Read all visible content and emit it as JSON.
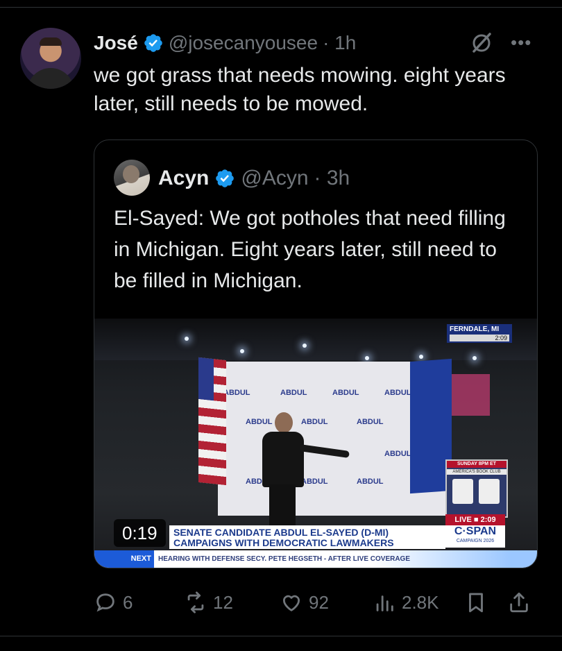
{
  "post": {
    "author_name": "José",
    "handle": "@josecanyousee",
    "time": "· 1h",
    "more": "•••",
    "text": "we got grass that needs mowing. eight years later, still needs to be mowed."
  },
  "quote": {
    "author_name": "Acyn",
    "handle": "@Acyn",
    "time": "· 3h",
    "text": "El-Sayed: We got potholes that need filling in Michigan. Eight years later, still need to be filled in Michigan.",
    "video": {
      "duration": "0:19",
      "location": "FERNDALE, MI",
      "clock": "2:09",
      "inset_top": "SUNDAY 8PM ET",
      "inset_show": "AMERICA'S BOOK CLUB",
      "live_label": "LIVE",
      "live_time": "2:09",
      "network": "C·SPAN",
      "network_sub": "CAMPAIGN 2026",
      "chyron_line1": "SENATE CANDIDATE ABDUL EL-SAYED (D-MI)",
      "chyron_line2": "CAMPAIGNS WITH DEMOCRATIC LAWMAKERS",
      "next_label": "NEXT",
      "next_text": "HEARING WITH DEFENSE SECY. PETE HEGSETH - AFTER LIVE COVERAGE",
      "backdrop_text": "ABDUL"
    }
  },
  "actions": {
    "replies": "6",
    "reposts": "12",
    "likes": "92",
    "views": "2.8K"
  },
  "icons": [
    "verified-badge-icon",
    "grok-icon",
    "more-icon",
    "reply-icon",
    "repost-icon",
    "like-icon",
    "views-icon",
    "bookmark-icon",
    "share-icon"
  ],
  "colors": {
    "background": "#000000",
    "text": "#e7e9ea",
    "muted": "#71767b",
    "verified": "#1d9bf0",
    "border": "#2f3336"
  }
}
